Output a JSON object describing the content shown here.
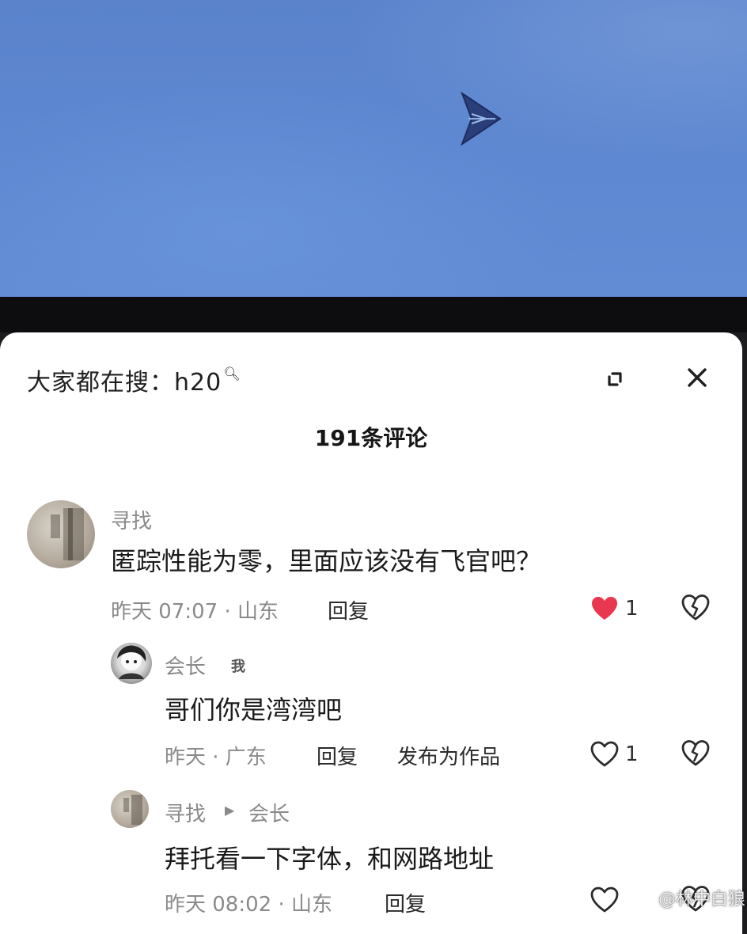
{
  "search_bar": {
    "label": "大家都在搜：h20",
    "search_icon": "search-icon"
  },
  "comment_count": "191条评论",
  "comments": [
    {
      "username": "寻找",
      "text": "匿踪性能为零，里面应该没有飞官吧？",
      "meta": "昨天 07:07 · 山东",
      "reply_label": "回复",
      "likes": "1",
      "liked": true
    },
    {
      "username": "会长",
      "badge": "我",
      "text": "哥们你是湾湾吧",
      "meta": "昨天 · 广东",
      "reply_label": "回复",
      "publish_label": "发布为作品",
      "likes": "1",
      "liked": false
    },
    {
      "username": "寻找",
      "reply_to": "会长",
      "text": "拜托看一下字体，和网路地址",
      "meta": "昨天 08:02 · 山东",
      "reply_label": "回复",
      "liked": false
    }
  ],
  "watermark": "@林中白狼",
  "colors": {
    "sky": "#5e88d1",
    "like_red": "#e8384f",
    "meta_gray": "#8a8a8a"
  }
}
